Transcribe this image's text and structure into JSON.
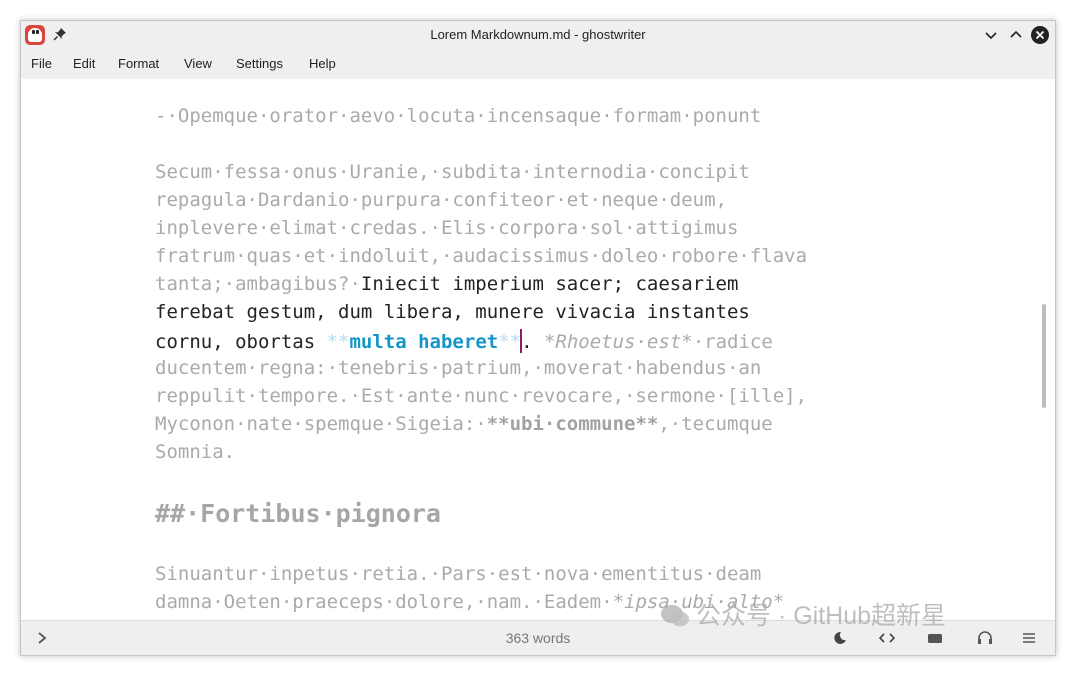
{
  "window": {
    "title": "Lorem Markdownum.md - ghostwriter"
  },
  "menu": [
    "File",
    "Edit",
    "Format",
    "View",
    "Settings",
    "Help"
  ],
  "editor": {
    "l1": "-·Opemque·orator·aevo·locuta·incensaque·formam·ponunt",
    "l2": "Secum·fessa·onus·Uranie,·subdita·internodia·concipit",
    "l3": "repagula·Dardanio·purpura·confiteor·et·neque·deum,",
    "l4": "inplevere·elimat·credas.·Elis·corpora·sol·attigimus",
    "l5": "fratrum·quas·et·indoluit,·audacissimus·doleo·robore·flava",
    "l6a": "tanta;·ambagibus?·",
    "l6b": "Iniecit imperium sacer; caesariem",
    "l7": "ferebat gestum, dum libera, munere vivacia instantes",
    "l8a": "cornu, obortas ",
    "l8b": "**",
    "l8c": "multa haberet",
    "l8d": "**",
    "l8e": ".",
    "l8f": " *Rhoetus·est*",
    "l8g": "·radice",
    "l9": "ducentem·regna:·tenebris·patrium,·moverat·habendus·an",
    "l10": "reppulit·tempore.·Est·ante·nunc·revocare,·sermone·[ille],",
    "l11a": "Myconon·nate·spemque·Sigeia:·",
    "l11b": "**ubi·commune**",
    "l11c": ",·tecumque",
    "l12": "Somnia.",
    "heading": "##·Fortibus·pignora",
    "l13": "Sinuantur·inpetus·retia.·Pars·est·nova·ementitus·deam",
    "l14a": "damna·Oeten·praeceps·dolore,·nam.·Eadem·",
    "l14b": "*ipsa·ubi·alto*"
  },
  "status": {
    "word_count": "363 words"
  },
  "watermark": {
    "text": "公众号 · GitHub超新星"
  },
  "colors": {
    "accent": "#1596c7",
    "cursor": "#8b1f5b",
    "markup": "#b6dbee",
    "dim_text": "#aaaaaa"
  },
  "icons": [
    "ghostwriter-app-icon",
    "pin-icon",
    "minimize-icon",
    "maximize-icon",
    "close-icon",
    "chevron-right-icon",
    "moon-icon",
    "code-icon",
    "keyboard-icon",
    "headphones-icon",
    "settings-icon"
  ]
}
